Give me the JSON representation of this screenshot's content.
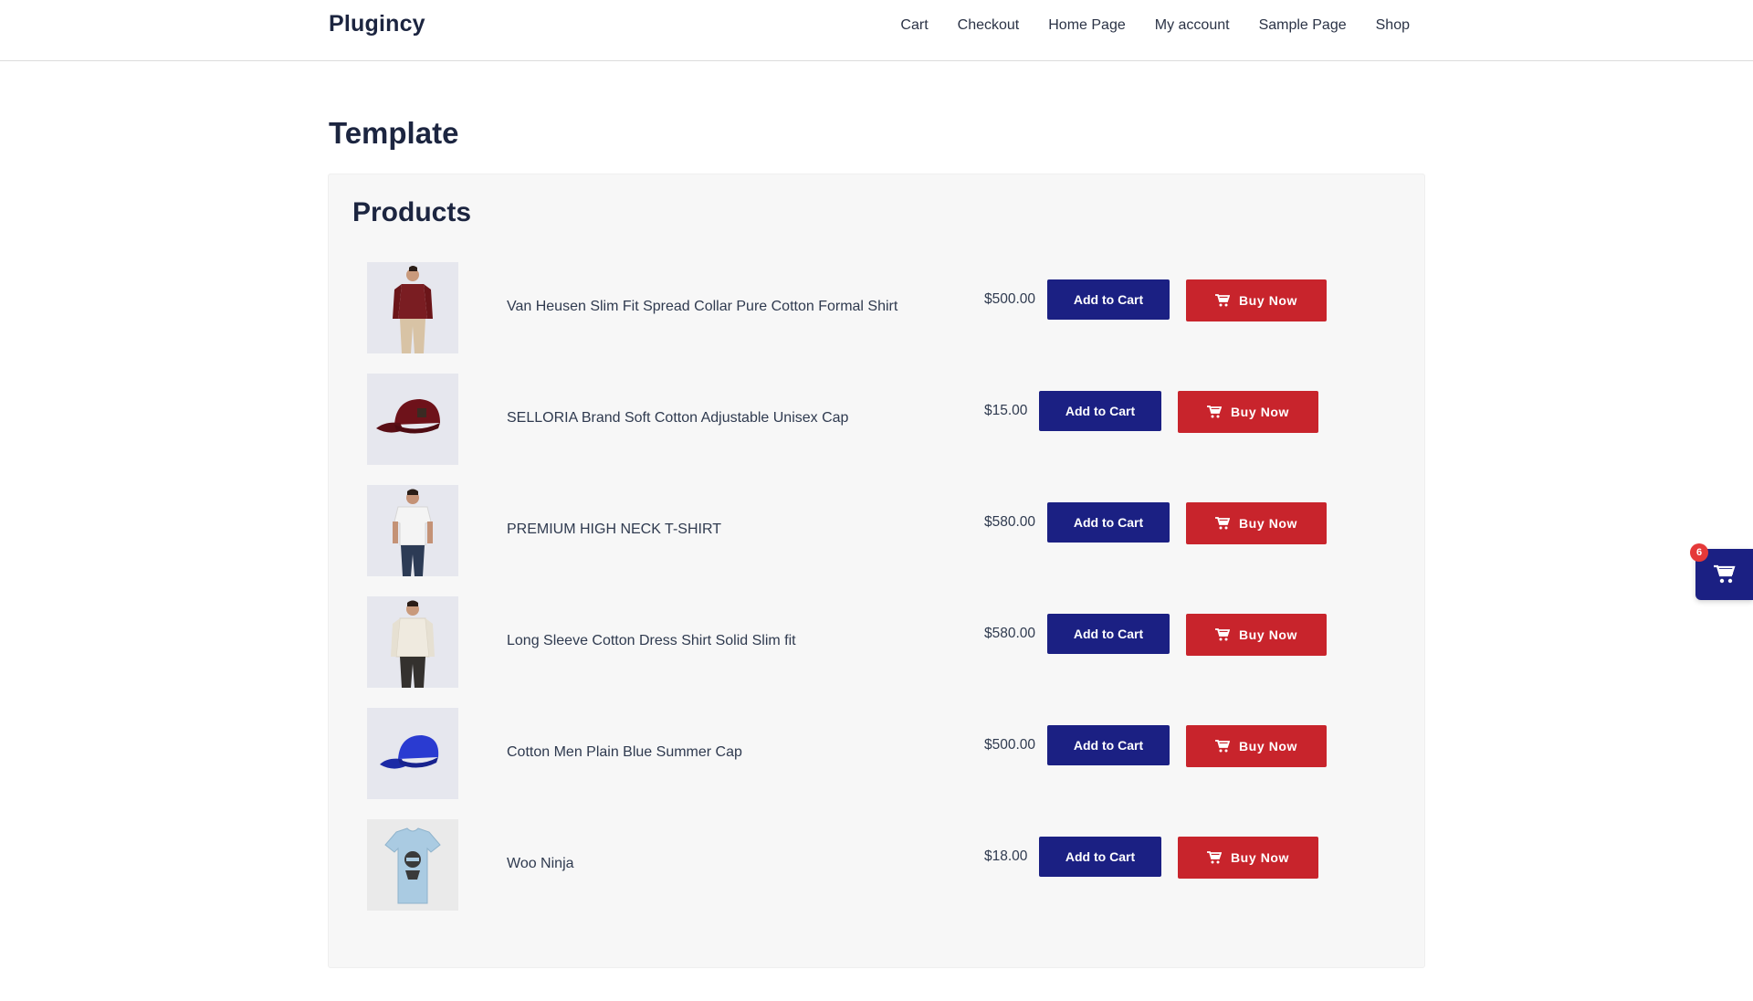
{
  "site": {
    "brand": "Plugincy"
  },
  "nav": {
    "items": [
      {
        "label": "Cart"
      },
      {
        "label": "Checkout"
      },
      {
        "label": "Home Page"
      },
      {
        "label": "My account"
      },
      {
        "label": "Sample Page"
      },
      {
        "label": "Shop"
      }
    ]
  },
  "page": {
    "title": "Template"
  },
  "products": {
    "title": "Products",
    "add_label": "Add to Cart",
    "buy_label": "Buy Now",
    "items": [
      {
        "name": "Van Heusen Slim Fit Spread Collar Pure Cotton Formal Shirt",
        "price": "$500.00",
        "image_icon": "maroon-shirt-image"
      },
      {
        "name": "SELLORIA Brand Soft Cotton Adjustable Unisex Cap",
        "price": "$15.00",
        "image_icon": "maroon-cap-image"
      },
      {
        "name": "PREMIUM HIGH NECK T-SHIRT",
        "price": "$580.00",
        "image_icon": "white-tshirt-image"
      },
      {
        "name": "Long Sleeve Cotton Dress Shirt Solid Slim fit",
        "price": "$580.00",
        "image_icon": "cream-shirt-image"
      },
      {
        "name": "Cotton Men Plain Blue Summer Cap",
        "price": "$500.00",
        "image_icon": "blue-cap-image"
      },
      {
        "name": "Woo Ninja",
        "price": "$18.00",
        "image_icon": "ninja-tshirt-image"
      }
    ]
  },
  "floating_cart": {
    "count": "6",
    "icon": "cart-icon"
  },
  "colors": {
    "add_button": "#1b2083",
    "buy_button": "#c8242c",
    "badge": "#e53939"
  }
}
